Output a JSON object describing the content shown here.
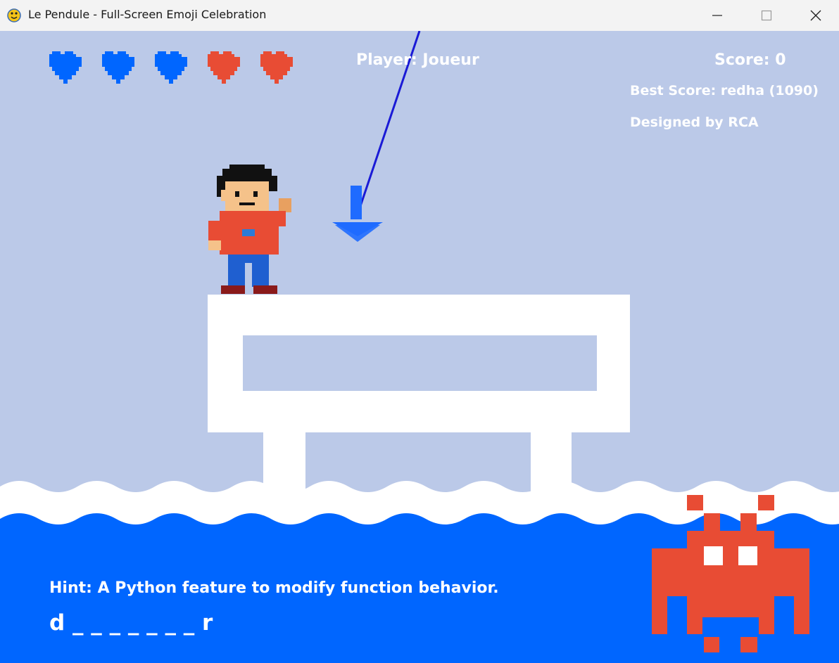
{
  "window": {
    "title": "Le Pendule - Full-Screen Emoji Celebration",
    "app_icon": "python-snake-icon"
  },
  "hud": {
    "player_label": "Player: Joueur",
    "score_label": "Score: 0",
    "best_score_label": "Best Score: redha (1090)",
    "credit": "Designed by RCA",
    "lives": {
      "total": 5,
      "blue_hearts": 3,
      "red_hearts": 2,
      "colors": {
        "blue": "#0066ff",
        "red": "#e84c34"
      }
    }
  },
  "puzzle": {
    "hint": "Hint: A Python feature to modify function behavior.",
    "word_display": "d _ _ _ _ _ _ _ r"
  },
  "colors": {
    "sky": "#bbc9e8",
    "water": "#0066ff",
    "wave_foam": "#ffffff",
    "structure": "#ffffff",
    "invader": "#e84c34",
    "pendulum": "#1a1ad6",
    "arrow": "#1f6bff"
  },
  "icons": [
    "minimize-icon",
    "maximize-icon",
    "close-icon",
    "heart-icon",
    "down-arrow-icon",
    "space-invader-icon",
    "character-sprite"
  ]
}
